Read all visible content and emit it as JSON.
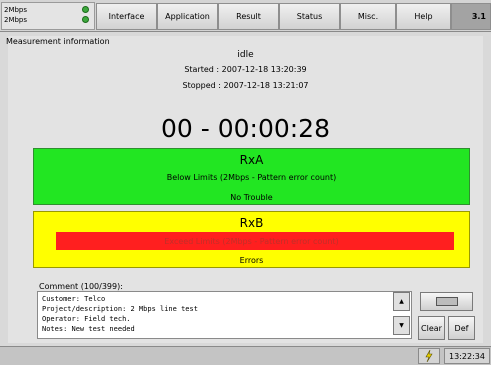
{
  "signal": {
    "line1": "2Mbps",
    "line2": "2Mbps"
  },
  "menu": {
    "interface": "Interface",
    "application": "Application",
    "result": "Result",
    "status": "Status",
    "misc": "Misc.",
    "help": "Help",
    "version": "3.1"
  },
  "measurement": {
    "title": "Measurement information",
    "state": "idle",
    "started": "Started : 2007-12-18 13:20:39",
    "stopped": "Stopped : 2007-12-18 13:21:07",
    "timer": "00 - 00:00:28"
  },
  "rxa": {
    "title": "RxA",
    "message": "Below Limits (2Mbps - Pattern error count)",
    "status": "No Trouble"
  },
  "rxb": {
    "title": "RxB",
    "message": "Exceed Limits (2Mbps - Pattern error count)",
    "status": "Errors"
  },
  "comment": {
    "label": "Comment (100/399):",
    "lines": [
      "Customer: Telco",
      "Project/description: 2 Mbps line test",
      "Operator: Field tech.",
      "Notes: New test needed"
    ]
  },
  "buttons": {
    "clear": "Clear",
    "def": "Def"
  },
  "clock": "13:22:34",
  "colors": {
    "rxa_bg": "#22e622",
    "rxb_bg": "#ffff00",
    "rxb_alert": "#ff1f1f"
  }
}
